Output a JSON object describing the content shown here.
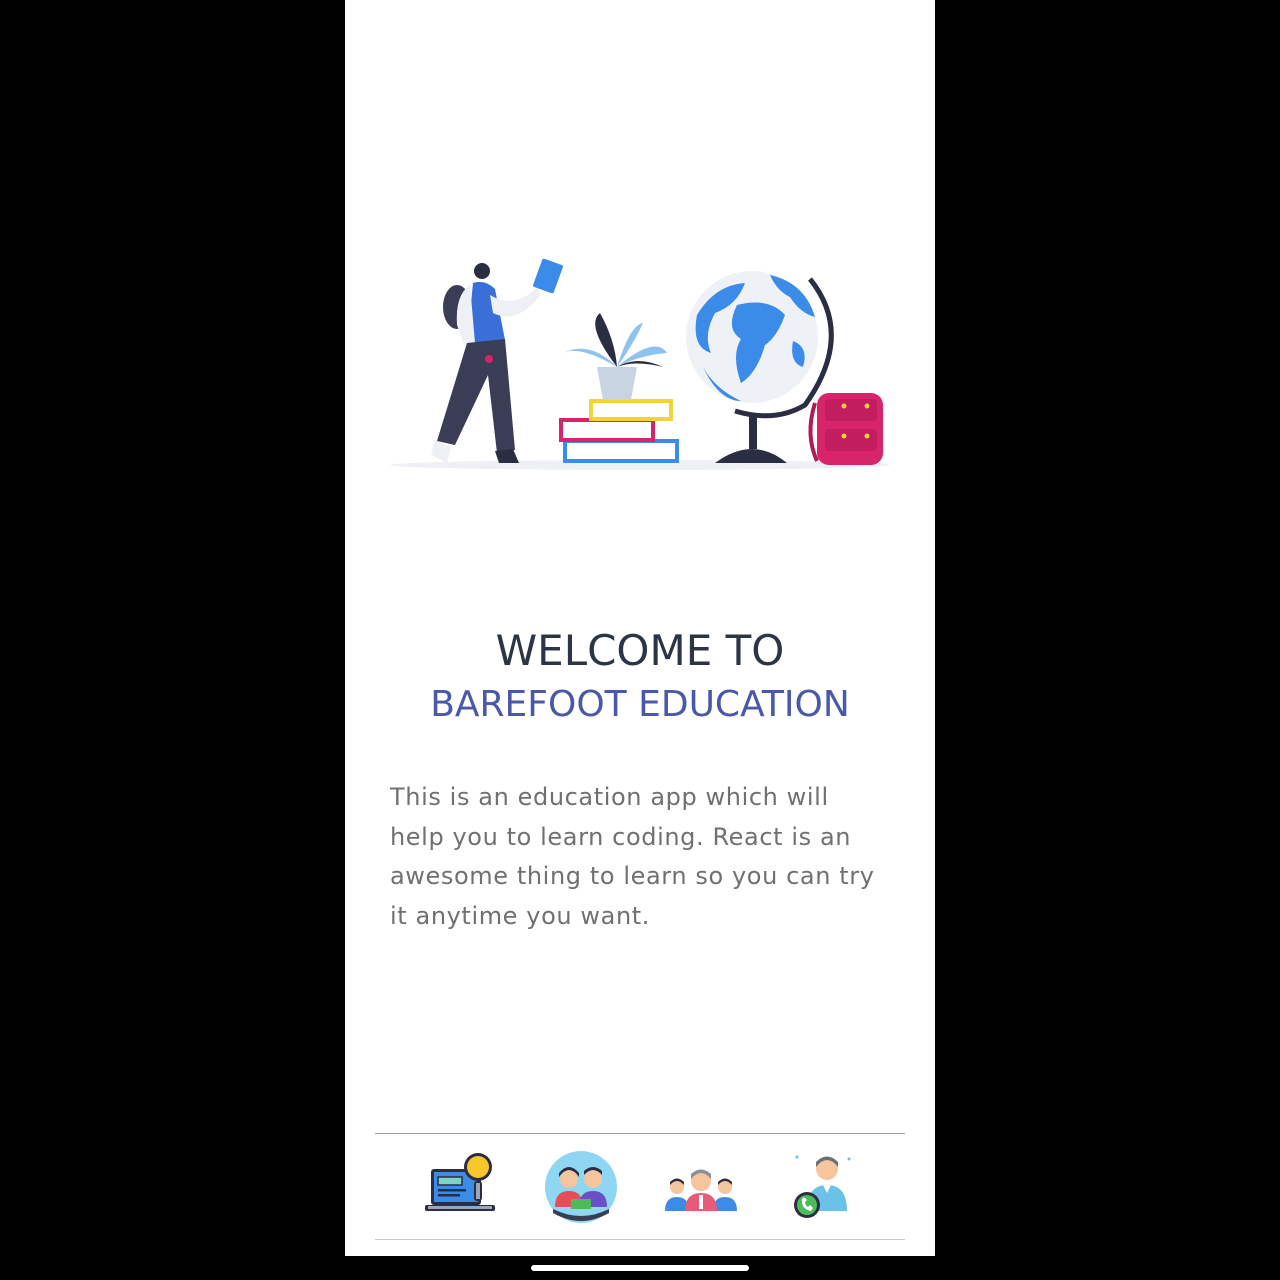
{
  "welcome": {
    "line1": "WELCOME TO",
    "line2": "BAREFOOT EDUCATION"
  },
  "description": [
    "This is an education app which will",
    "help you to learn coding. React is an",
    "awesome thing to learn so you can try",
    "it anytime you want."
  ],
  "nav": {
    "items": [
      {
        "icon": "laptop-search-icon"
      },
      {
        "icon": "students-icon"
      },
      {
        "icon": "team-icon"
      },
      {
        "icon": "contact-support-icon"
      }
    ]
  },
  "colors": {
    "heading": "#2c3545",
    "brand": "#4a58a8",
    "body_text": "#707070",
    "background": "#ffffff"
  }
}
